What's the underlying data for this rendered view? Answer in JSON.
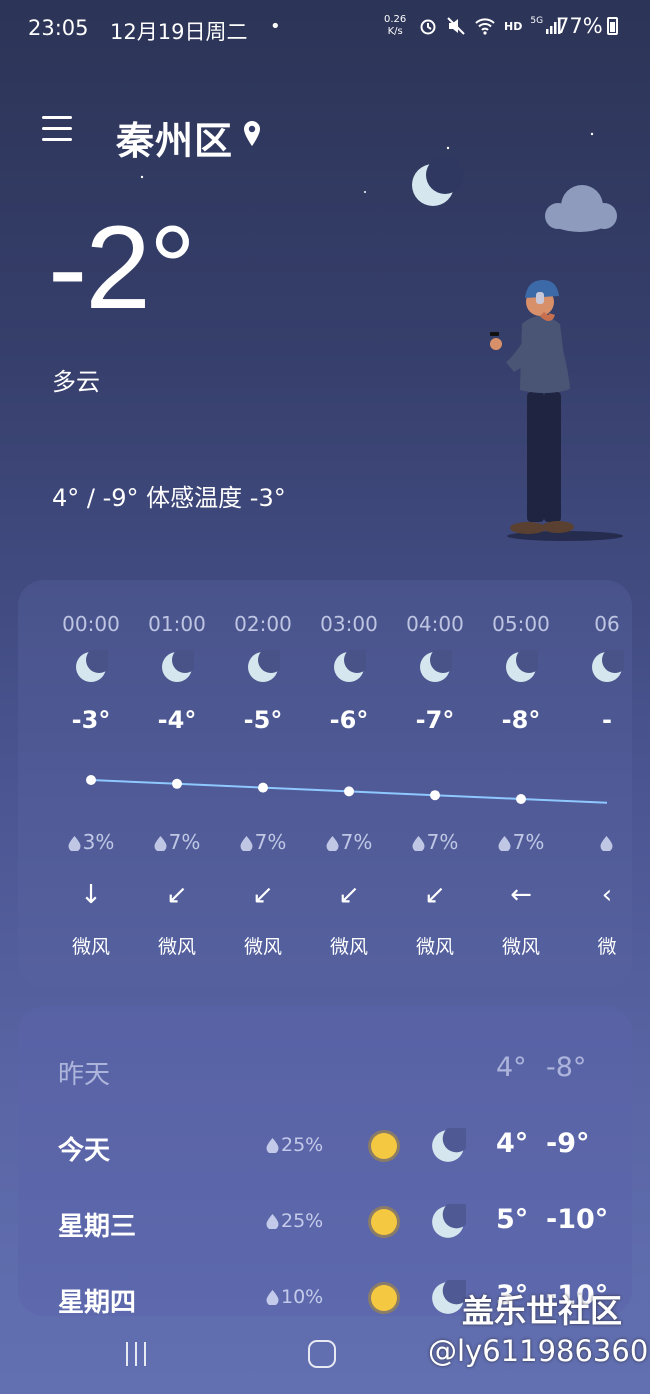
{
  "status_bar": {
    "time": "23:05",
    "date": "12月19日周二",
    "dot": "•",
    "net_speed": "0.26",
    "net_unit": "K/s",
    "network": "HD",
    "signal": "5G",
    "battery": "77%"
  },
  "header": {
    "city": "秦州区"
  },
  "current": {
    "temperature": "-2°",
    "condition": "多云",
    "hi_lo_feels": "4° / -9° 体感温度 -3°"
  },
  "hourly": [
    {
      "time": "00:00",
      "temp": "-3°",
      "rain": "3%",
      "wind_arrow": "↓",
      "wind": "微风",
      "value": -3
    },
    {
      "time": "01:00",
      "temp": "-4°",
      "rain": "7%",
      "wind_arrow": "↙",
      "wind": "微风",
      "value": -4
    },
    {
      "time": "02:00",
      "temp": "-5°",
      "rain": "7%",
      "wind_arrow": "↙",
      "wind": "微风",
      "value": -5
    },
    {
      "time": "03:00",
      "temp": "-6°",
      "rain": "7%",
      "wind_arrow": "↙",
      "wind": "微风",
      "value": -6
    },
    {
      "time": "04:00",
      "temp": "-7°",
      "rain": "7%",
      "wind_arrow": "↙",
      "wind": "微风",
      "value": -7
    },
    {
      "time": "05:00",
      "temp": "-8°",
      "rain": "7%",
      "wind_arrow": "←",
      "wind": "微风",
      "value": -8
    },
    {
      "time": "06",
      "temp": "-",
      "rain": "",
      "wind_arrow": "‹",
      "wind": "微",
      "value": -9
    }
  ],
  "daily": [
    {
      "day": "昨天",
      "rain": "",
      "hi": "4°",
      "lo": "-8°",
      "dim": true
    },
    {
      "day": "今天",
      "rain": "25%",
      "hi": "4°",
      "lo": "-9°",
      "dim": false
    },
    {
      "day": "星期三",
      "rain": "25%",
      "hi": "5°",
      "lo": "-10°",
      "dim": false
    },
    {
      "day": "星期四",
      "rain": "10%",
      "hi": "3°",
      "lo": "-10°",
      "dim": false
    }
  ],
  "watermark": {
    "site": "盖乐世社区",
    "user": "@ly611986360"
  },
  "colors": {
    "line": "#8ec8ff",
    "sun": "#f5c842",
    "moon": "#d6e6ee"
  }
}
